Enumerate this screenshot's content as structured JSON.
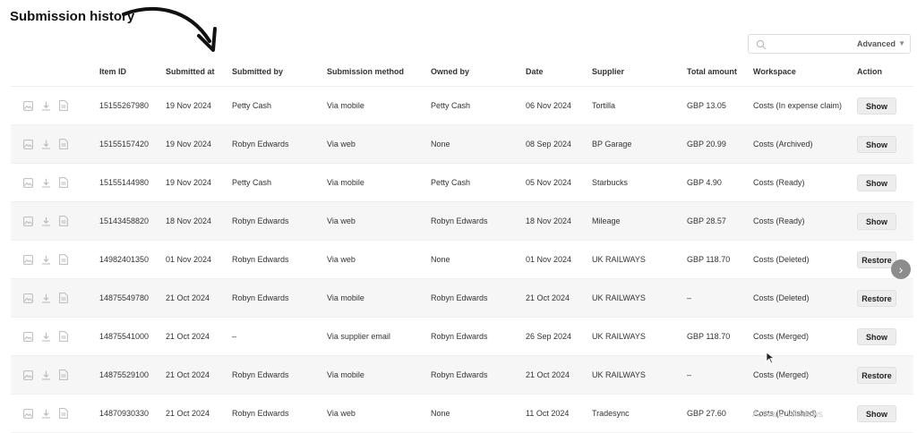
{
  "page": {
    "title": "Submission history",
    "watermark": "Activate Windows"
  },
  "search": {
    "placeholder": "",
    "advanced_label": "Advanced",
    "advanced_icon": "chevron-down-icon"
  },
  "table": {
    "columns": {
      "item_id": "Item ID",
      "submitted_at": "Submitted at",
      "submitted_by": "Submitted by",
      "method": "Submission method",
      "owned_by": "Owned by",
      "date": "Date",
      "supplier": "Supplier",
      "total": "Total amount",
      "workspace": "Workspace",
      "action": "Action"
    },
    "rows": [
      {
        "item_id": "15155267980",
        "submitted_at": "19 Nov 2024",
        "submitted_by": "Petty Cash",
        "method": "Via mobile",
        "owned_by": "Petty Cash",
        "date": "06 Nov 2024",
        "supplier": "Tortilla",
        "total": "GBP 13.05",
        "workspace": "Costs (In expense claim)",
        "action": "Show"
      },
      {
        "item_id": "15155157420",
        "submitted_at": "19 Nov 2024",
        "submitted_by": "Robyn Edwards",
        "method": "Via web",
        "owned_by": "None",
        "date": "08 Sep 2024",
        "supplier": "BP Garage",
        "total": "GBP 20.99",
        "workspace": "Costs (Archived)",
        "action": "Show"
      },
      {
        "item_id": "15155144980",
        "submitted_at": "19 Nov 2024",
        "submitted_by": "Petty Cash",
        "method": "Via mobile",
        "owned_by": "Petty Cash",
        "date": "05 Nov 2024",
        "supplier": "Starbucks",
        "total": "GBP 4.90",
        "workspace": "Costs (Ready)",
        "action": "Show"
      },
      {
        "item_id": "15143458820",
        "submitted_at": "18 Nov 2024",
        "submitted_by": "Robyn Edwards",
        "method": "Via web",
        "owned_by": "Robyn Edwards",
        "date": "18 Nov 2024",
        "supplier": "Mileage",
        "total": "GBP 28.57",
        "workspace": "Costs (Ready)",
        "action": "Show"
      },
      {
        "item_id": "14982401350",
        "submitted_at": "01 Nov 2024",
        "submitted_by": "Robyn Edwards",
        "method": "Via web",
        "owned_by": "None",
        "date": "01 Nov 2024",
        "supplier": "UK RAILWAYS",
        "total": "GBP 118.70",
        "workspace": "Costs (Deleted)",
        "action": "Restore"
      },
      {
        "item_id": "14875549780",
        "submitted_at": "21 Oct 2024",
        "submitted_by": "Robyn Edwards",
        "method": "Via mobile",
        "owned_by": "Robyn Edwards",
        "date": "21 Oct 2024",
        "supplier": "UK RAILWAYS",
        "total": "–",
        "workspace": "Costs (Deleted)",
        "action": "Restore"
      },
      {
        "item_id": "14875541000",
        "submitted_at": "21 Oct 2024",
        "submitted_by": "–",
        "method": "Via supplier email",
        "owned_by": "Robyn Edwards",
        "date": "26 Sep 2024",
        "supplier": "UK RAILWAYS",
        "total": "GBP 118.70",
        "workspace": "Costs (Merged)",
        "action": "Show"
      },
      {
        "item_id": "14875529100",
        "submitted_at": "21 Oct 2024",
        "submitted_by": "Robyn Edwards",
        "method": "Via mobile",
        "owned_by": "Robyn Edwards",
        "date": "21 Oct 2024",
        "supplier": "UK RAILWAYS",
        "total": "–",
        "workspace": "Costs (Merged)",
        "action": "Restore"
      },
      {
        "item_id": "14870930330",
        "submitted_at": "21 Oct 2024",
        "submitted_by": "Robyn Edwards",
        "method": "Via web",
        "owned_by": "None",
        "date": "11 Oct 2024",
        "supplier": "Tradesync",
        "total": "GBP 27.60",
        "workspace": "Costs (Published)",
        "action": "Show"
      }
    ]
  },
  "icons": {
    "image": "image-icon",
    "download": "download-icon",
    "document": "document-icon",
    "next": "arrow-right-icon"
  },
  "colors": {
    "button_bg": "#ededed",
    "row_alt": "#f6f6f6"
  }
}
